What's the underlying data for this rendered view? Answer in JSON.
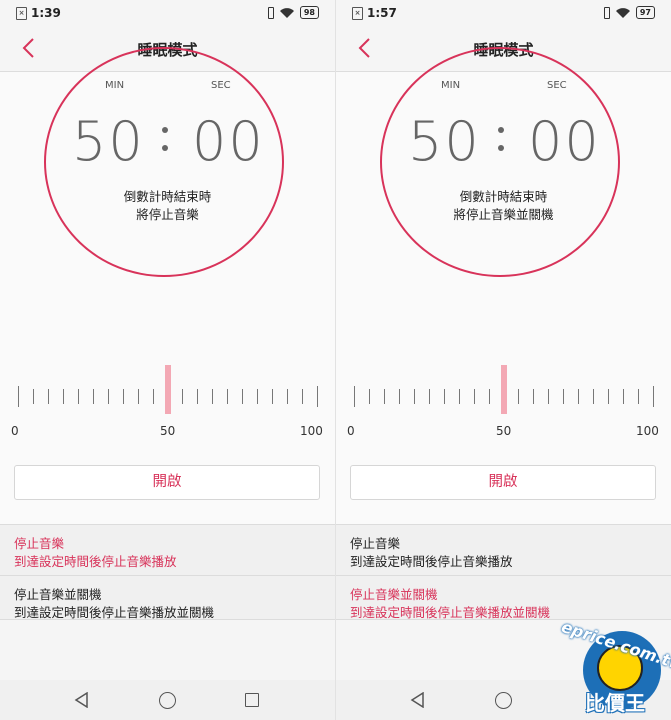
{
  "screens": [
    {
      "status": {
        "time": "1:39",
        "battery": "98"
      },
      "header": {
        "title": "睡眠模式"
      },
      "timer": {
        "min_label": "MIN",
        "sec_label": "SEC",
        "minutes": "50",
        "seconds": "00",
        "message_line1": "倒數計時結束時",
        "message_line2": "將停止音樂"
      },
      "slider": {
        "value": 50,
        "label_0": "0",
        "label_50": "50",
        "label_100": "100"
      },
      "start_button": "開啟",
      "options": [
        {
          "title": "停止音樂",
          "desc": "到達設定時間後停止音樂播放",
          "selected": true
        },
        {
          "title": "停止音樂並關機",
          "desc": "到達設定時間後停止音樂播放並關機",
          "selected": false
        }
      ]
    },
    {
      "status": {
        "time": "1:57",
        "battery": "97"
      },
      "header": {
        "title": "睡眠模式"
      },
      "timer": {
        "min_label": "MIN",
        "sec_label": "SEC",
        "minutes": "50",
        "seconds": "00",
        "message_line1": "倒數計時結束時",
        "message_line2": "將停止音樂並關機"
      },
      "slider": {
        "value": 50,
        "label_0": "0",
        "label_50": "50",
        "label_100": "100"
      },
      "start_button": "開啟",
      "options": [
        {
          "title": "停止音樂",
          "desc": "到達設定時間後停止音樂播放",
          "selected": false
        },
        {
          "title": "停止音樂並關機",
          "desc": "到達設定時間後停止音樂播放並關機",
          "selected": true
        }
      ]
    }
  ],
  "watermark": {
    "top_text": "eprice.com.tw",
    "bottom_text": "比價王"
  },
  "colors": {
    "accent": "#d8335a",
    "indicator": "#f3a8b4"
  }
}
